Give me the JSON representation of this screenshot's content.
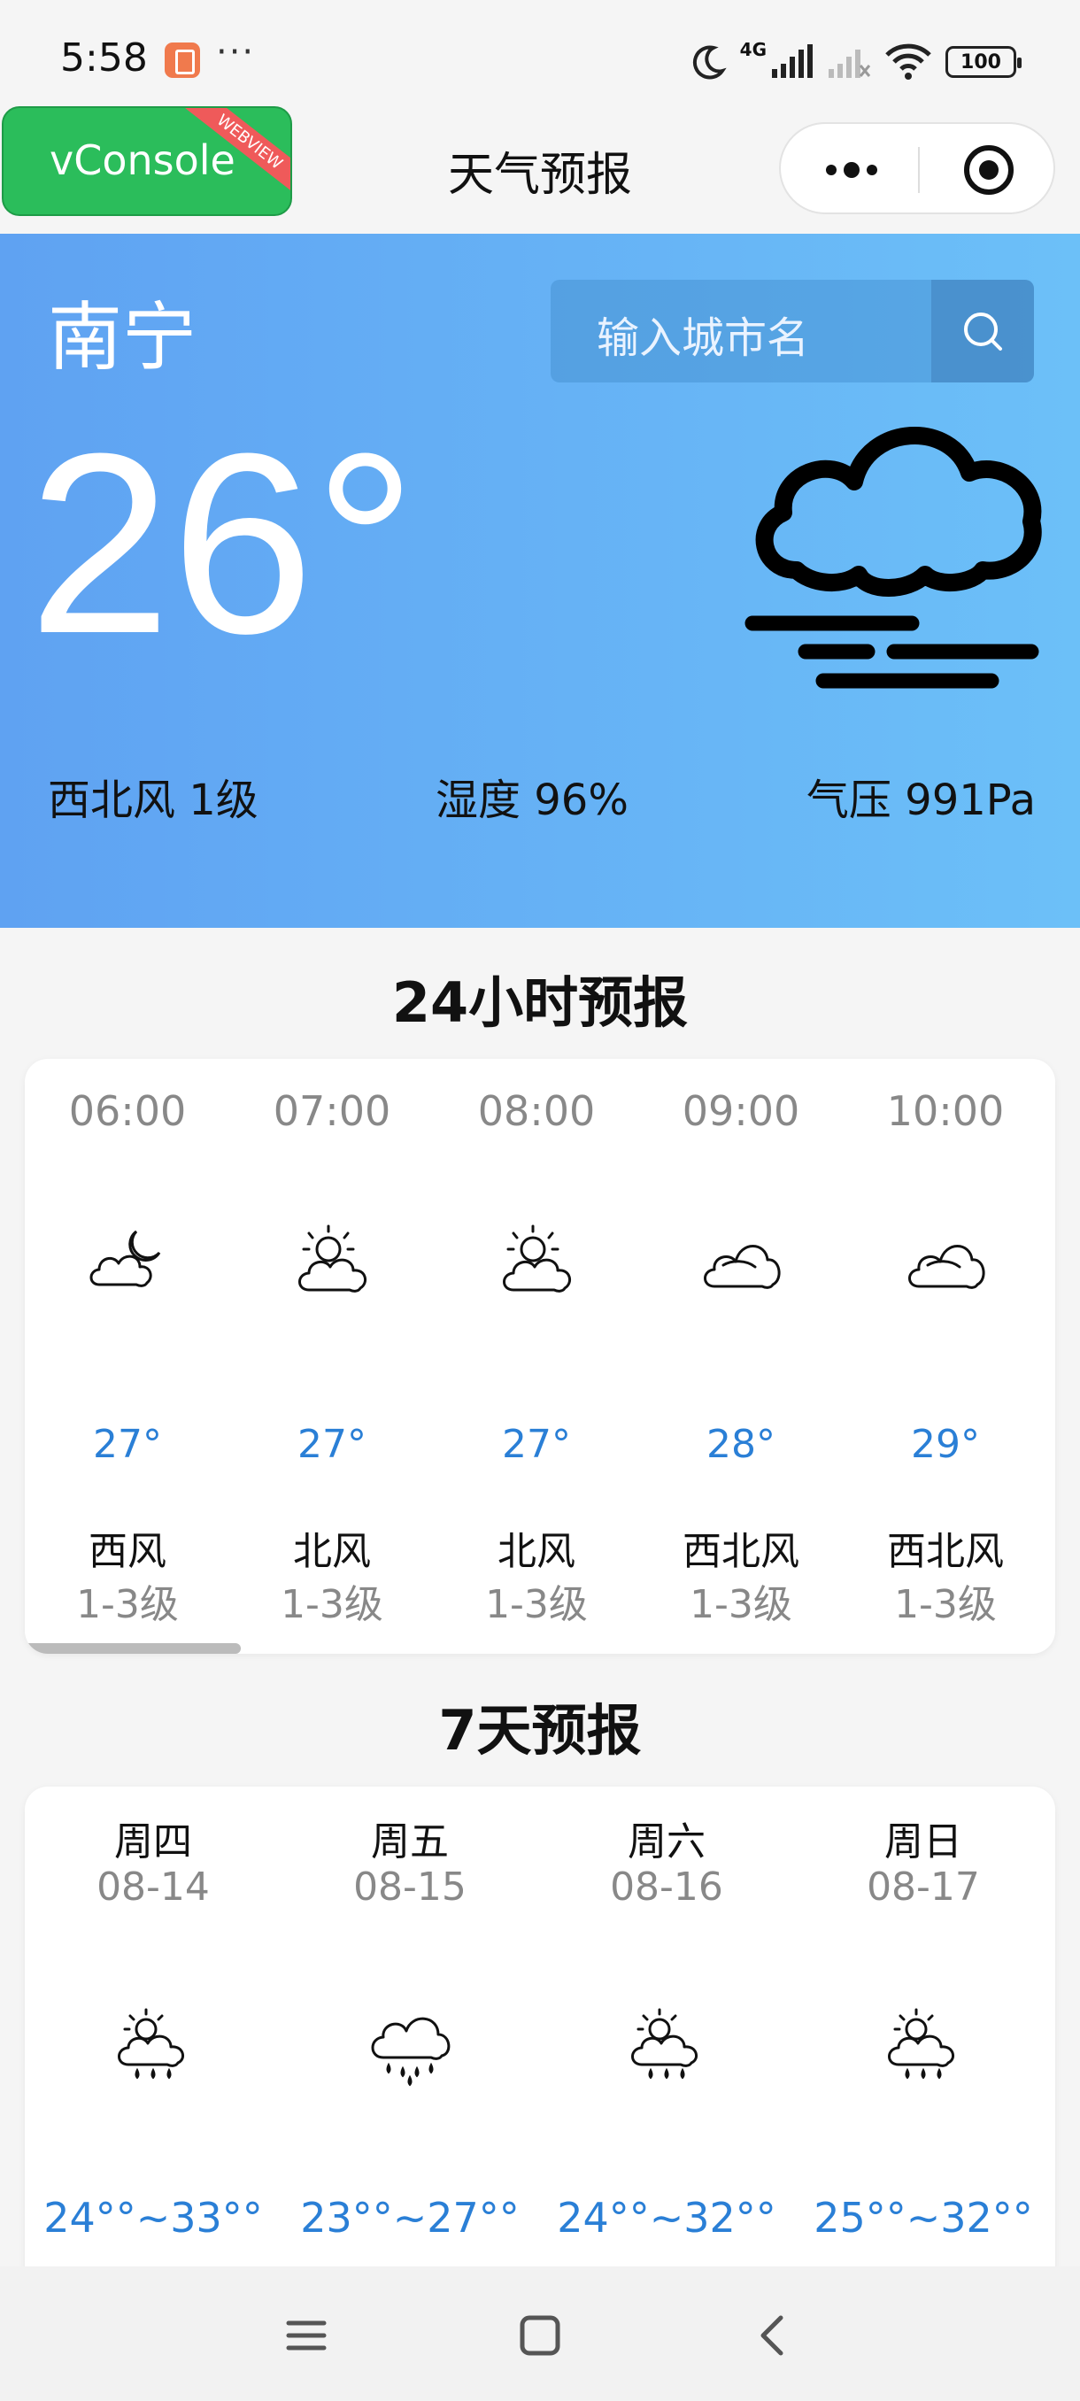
{
  "status_bar": {
    "time": "5:58",
    "more": "···",
    "network": "4G",
    "battery": "100"
  },
  "nav": {
    "vconsole_label": "vConsole",
    "vconsole_ribbon": "WEBVIEW",
    "title": "天气预报"
  },
  "current": {
    "city": "南宁",
    "search_placeholder": "输入城市名",
    "temperature": "26°",
    "condition_icon": "cloudy-fog-icon",
    "wind": "西北风 1级",
    "humidity": "湿度 96%",
    "pressure": "气压 991Pa"
  },
  "hourly": {
    "title": "24小时预报",
    "items": [
      {
        "time": "06:00",
        "icon": "partly-cloudy-night-icon",
        "temp": "27°",
        "wind_dir": "西风",
        "wind_level": "1-3级"
      },
      {
        "time": "07:00",
        "icon": "partly-cloudy-day-icon",
        "temp": "27°",
        "wind_dir": "北风",
        "wind_level": "1-3级"
      },
      {
        "time": "08:00",
        "icon": "partly-cloudy-day-icon",
        "temp": "27°",
        "wind_dir": "北风",
        "wind_level": "1-3级"
      },
      {
        "time": "09:00",
        "icon": "cloudy-icon",
        "temp": "28°",
        "wind_dir": "西北风",
        "wind_level": "1-3级"
      },
      {
        "time": "10:00",
        "icon": "cloudy-icon",
        "temp": "29°",
        "wind_dir": "西北风",
        "wind_level": "1-3级"
      }
    ]
  },
  "daily": {
    "title": "7天预报",
    "items": [
      {
        "weekday": "周四",
        "date": "08-14",
        "icon": "sun-shower-icon",
        "range": "24°°~33°°"
      },
      {
        "weekday": "周五",
        "date": "08-15",
        "icon": "rain-icon",
        "range": "23°°~27°°"
      },
      {
        "weekday": "周六",
        "date": "08-16",
        "icon": "sun-shower-icon",
        "range": "24°°~32°°"
      },
      {
        "weekday": "周日",
        "date": "08-17",
        "icon": "sun-shower-icon",
        "range": "25°°~32°°"
      }
    ]
  }
}
